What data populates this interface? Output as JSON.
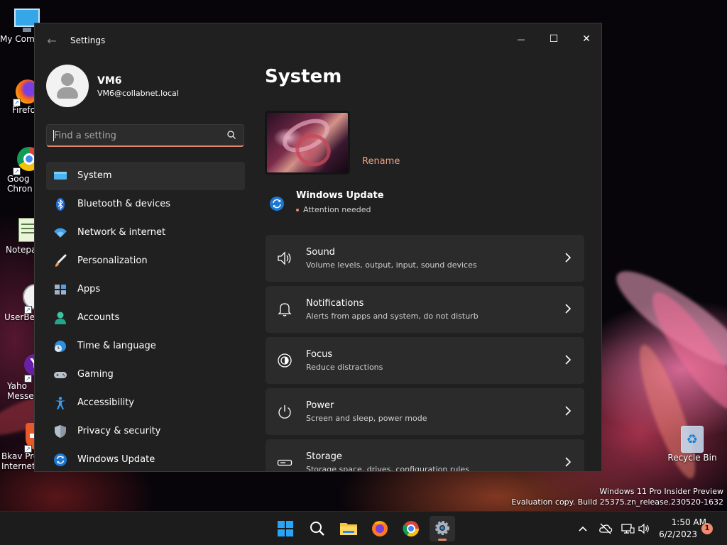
{
  "desktop": {
    "icons": [
      {
        "label": "My Com",
        "name": "my-computer"
      },
      {
        "label": "Firefo",
        "name": "firefox"
      },
      {
        "label": "Goog\nChron",
        "name": "google-chrome"
      },
      {
        "label": "Notepa",
        "name": "notepad"
      },
      {
        "label": "UserBen",
        "name": "userbenchmark"
      },
      {
        "label": "Yaho\nMesser",
        "name": "yahoo-messenger"
      },
      {
        "label": "Bkav Pro\nInternet Sec",
        "name": "bkav-pro"
      },
      {
        "label": "Recycle Bin",
        "name": "recycle-bin"
      }
    ],
    "watermark_line1": "Windows 11 Pro Insider Preview",
    "watermark_line2": "Evaluation copy. Build 25375.zn_release.230520-1632"
  },
  "window": {
    "title": "Settings",
    "back_icon": "arrow-left-icon",
    "minimize_glyph": "—",
    "maximize_glyph": "☐",
    "close_glyph": "✕"
  },
  "account": {
    "name": "VM6",
    "email": "VM6@collabnet.local"
  },
  "search": {
    "placeholder": "Find a setting",
    "value": ""
  },
  "nav": [
    {
      "label": "System",
      "icon": "monitor-icon",
      "active": true
    },
    {
      "label": "Bluetooth & devices",
      "icon": "bluetooth-icon"
    },
    {
      "label": "Network & internet",
      "icon": "wifi-icon"
    },
    {
      "label": "Personalization",
      "icon": "brush-icon"
    },
    {
      "label": "Apps",
      "icon": "apps-icon"
    },
    {
      "label": "Accounts",
      "icon": "person-icon"
    },
    {
      "label": "Time & language",
      "icon": "globe-clock-icon"
    },
    {
      "label": "Gaming",
      "icon": "gamepad-icon"
    },
    {
      "label": "Accessibility",
      "icon": "accessibility-icon"
    },
    {
      "label": "Privacy & security",
      "icon": "shield-icon"
    },
    {
      "label": "Windows Update",
      "icon": "update-icon"
    }
  ],
  "main": {
    "title": "System",
    "rename": "Rename",
    "update": {
      "title": "Windows Update",
      "status": "Attention needed"
    },
    "cards": [
      {
        "title": "Sound",
        "subtitle": "Volume levels, output, input, sound devices",
        "icon": "speaker-icon"
      },
      {
        "title": "Notifications",
        "subtitle": "Alerts from apps and system, do not disturb",
        "icon": "bell-icon"
      },
      {
        "title": "Focus",
        "subtitle": "Reduce distractions",
        "icon": "focus-icon"
      },
      {
        "title": "Power",
        "subtitle": "Screen and sleep, power mode",
        "icon": "power-icon"
      },
      {
        "title": "Storage",
        "subtitle": "Storage space, drives, configuration rules",
        "icon": "storage-icon"
      }
    ]
  },
  "taskbar": {
    "apps": [
      "start",
      "search",
      "file-explorer",
      "firefox",
      "chrome",
      "settings"
    ],
    "time": "1:50 AM",
    "date": "6/2/2023",
    "notification_count": "1"
  },
  "colors": {
    "accent": "#e0876c",
    "window_bg": "#202020",
    "card_bg": "#2b2b2b"
  }
}
